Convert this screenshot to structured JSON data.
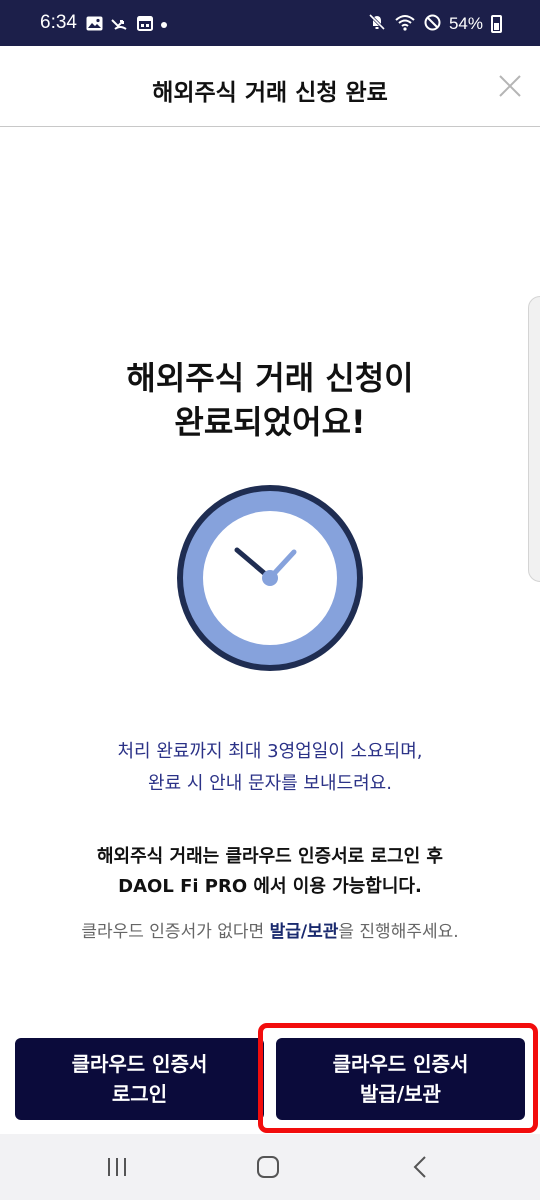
{
  "status_bar": {
    "time": "6:34",
    "battery_percent": "54%",
    "left_icons": [
      "image-icon",
      "missed-call-icon",
      "calendar-icon",
      "dot-icon"
    ],
    "right_icons": [
      "mute-icon",
      "wifi-icon",
      "do-not-disturb-icon",
      "battery-icon"
    ]
  },
  "header": {
    "title": "해외주식 거래 신청 완료",
    "close_icon": "close-icon"
  },
  "main": {
    "headline_line1": "해외주식 거래 신청이",
    "headline_line2": "완료되었어요!",
    "illustration": "clock-icon",
    "processing_line1": "처리 완료까지 최대 3영업일이 소요되며,",
    "processing_line2": "완료 시 안내 문자를 보내드려요.",
    "notice_line1": "해외주식 거래는 클라우드 인증서로 로그인 후",
    "notice_line2": "DAOL Fi PRO 에서 이용 가능합니다.",
    "hint_prefix": "클라우드 인증서가 없다면 ",
    "hint_link": "발급/보관",
    "hint_suffix": "을 진행해주세요."
  },
  "buttons": {
    "login_line1": "클라우드 인증서",
    "login_line2": "로그인",
    "issue_line1": "클라우드 인증서",
    "issue_line2": "발급/보관"
  },
  "nav_bar": {
    "items": [
      "recent-apps-icon",
      "home-icon",
      "back-icon"
    ]
  },
  "colors": {
    "status_bar": "#1c1f4a",
    "button": "#0b0b3b",
    "accent_text": "#2b3287",
    "clock_fill": "#86a2dc",
    "clock_ring": "#1f2d52",
    "highlight": "#f20d0d"
  }
}
